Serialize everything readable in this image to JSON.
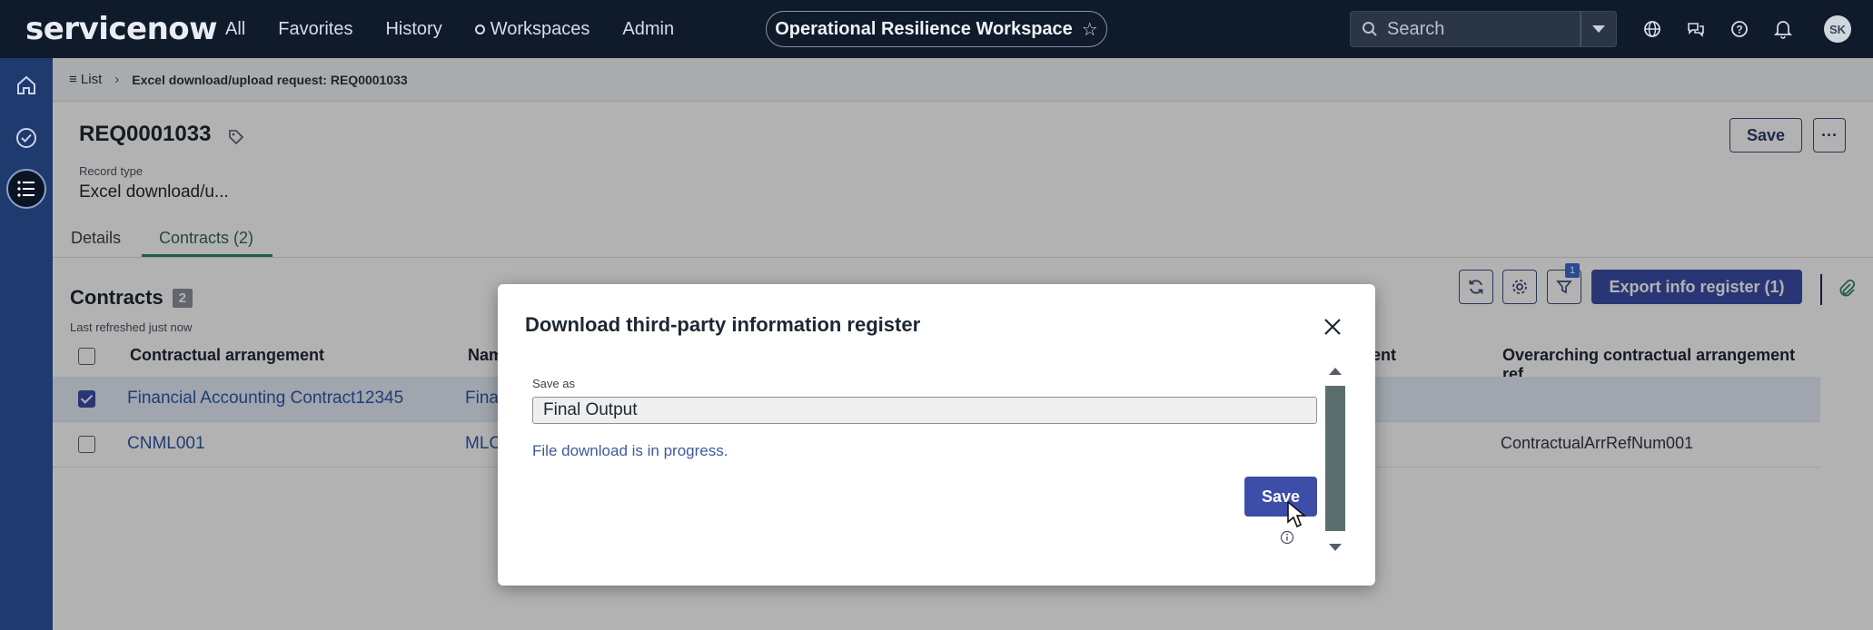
{
  "nav": {
    "logo": "servicenow",
    "links": [
      {
        "label": "All"
      },
      {
        "label": "Favorites"
      },
      {
        "label": "History"
      },
      {
        "label": "Workspaces"
      },
      {
        "label": "Admin"
      }
    ],
    "workspace": "Operational Resilience Workspace",
    "search_placeholder": "Search",
    "avatar_initials": "SK"
  },
  "breadcrumb": {
    "list": "List",
    "current": "Excel download/upload request: REQ0001033"
  },
  "record": {
    "id": "REQ0001033",
    "type_label": "Record type",
    "type_value": "Excel download/u...",
    "save_label": "Save",
    "more_label": "···"
  },
  "tabs": [
    {
      "label": "Details"
    },
    {
      "label": "Contracts (2)"
    }
  ],
  "contracts": {
    "title": "Contracts",
    "count": "2",
    "refreshed": "Last refreshed just now",
    "filter_count": "1",
    "export_label": "Export info register (1)",
    "columns": [
      "Contractual arrangement",
      "Nam",
      "ent",
      "Overarching contractual arrangement ref"
    ],
    "rows": [
      {
        "selected": true,
        "arrangement": "Financial Accounting Contract12345",
        "name": "Fina",
        "overarching": ""
      },
      {
        "selected": false,
        "arrangement": "CNML001",
        "name": "MLC",
        "overarching": "ContractualArrRefNum001"
      }
    ]
  },
  "modal": {
    "title": "Download third-party information register",
    "field_label": "Save as",
    "field_value": "Final Output",
    "progress_text": "File download is in progress.",
    "save_label": "Save"
  }
}
